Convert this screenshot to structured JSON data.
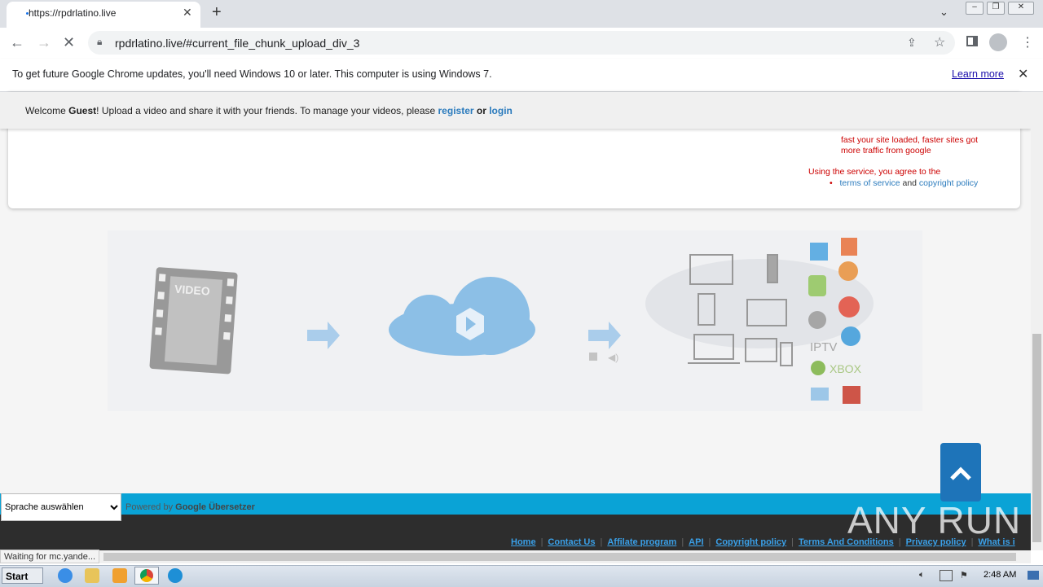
{
  "browser": {
    "tab_title": "https://rpdrlatino.live",
    "url": "rpdrlatino.live/#current_file_chunk_upload_div_3",
    "infobar_text": "To get future Google Chrome updates, you'll need Windows 10 or later. This computer is using Windows 7.",
    "learn_more": "Learn more"
  },
  "page": {
    "welcome_prefix": "Welcome ",
    "welcome_user": "Guest",
    "welcome_middle": "! Upload a video and share it with your friends. To manage your videos, please ",
    "register": "register",
    "or": " or ",
    "login": "login",
    "promo_line1": "fast your site loaded, faster sites got",
    "promo_line2": "more traffic from google",
    "agree_text": "Using the service, you agree to the",
    "terms": "terms of service",
    "and": " and ",
    "copyright": "copyright policy",
    "illustration_labels": {
      "video": "VIDEO",
      "iptv": "IPTV",
      "xbox": "XBOX"
    }
  },
  "translate": {
    "select_label": "Sprache auswählen",
    "powered_by": "Powered by ",
    "google_translate": "Google Übersetzer"
  },
  "footer": {
    "links": [
      "Home",
      "Contact Us",
      "Affilate program",
      "API",
      "Copyright policy",
      "Terms And Conditions",
      "Privacy policy",
      "What is i"
    ]
  },
  "status_text": "Waiting for mc.yande...",
  "watermark": "ANY RUN",
  "taskbar": {
    "start": "Start",
    "clock": "2:48 AM"
  }
}
